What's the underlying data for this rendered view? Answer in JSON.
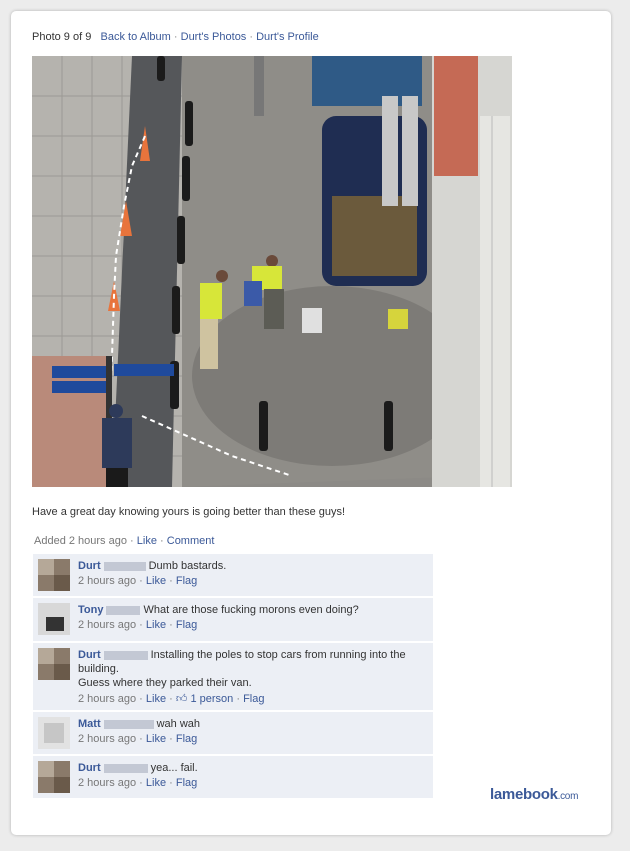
{
  "nav": {
    "photo_counter": "Photo 9 of 9",
    "back_link": "Back to Album",
    "photos_link": "Durt's Photos",
    "profile_link": "Durt's Profile",
    "separator": "·"
  },
  "caption": "Have a great day knowing yours is going better than these guys!",
  "post_meta": {
    "added": "Added 2 hours ago",
    "like": "Like",
    "comment": "Comment"
  },
  "comments": [
    {
      "name": "Durt",
      "text": "Dumb bastards.",
      "time": "2 hours ago",
      "like": "Like",
      "flag": "Flag"
    },
    {
      "name": "Tony",
      "text": "What are those fucking morons even doing?",
      "time": "2 hours ago",
      "like": "Like",
      "flag": "Flag"
    },
    {
      "name": "Durt",
      "text": "Installing the poles to stop cars from running into the building.",
      "text2": "Guess where they parked their van.",
      "time": "2 hours ago",
      "like": "Like",
      "likes_count": "1 person",
      "flag": "Flag"
    },
    {
      "name": "Matt",
      "text": "wah wah",
      "time": "2 hours ago",
      "like": "Like",
      "flag": "Flag"
    },
    {
      "name": "Durt",
      "text": "yea... fail.",
      "time": "2 hours ago",
      "like": "Like",
      "flag": "Flag"
    }
  ],
  "watermark": {
    "brand": "lamebook",
    "tld": ".com"
  },
  "colors": {
    "link": "#3b5998",
    "comment_bg": "#eceff5"
  }
}
